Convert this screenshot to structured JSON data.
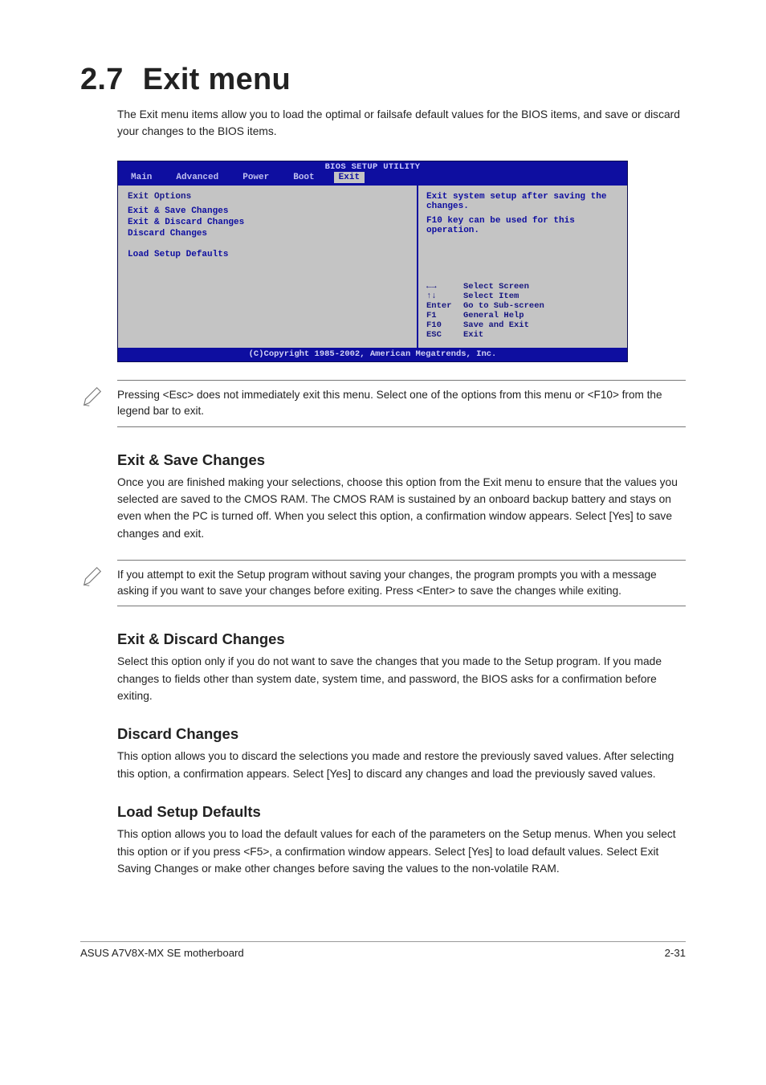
{
  "heading_number": "2.7",
  "heading_title": "Exit menu",
  "intro": "The Exit menu items allow you to load the optimal or failsafe default values for the BIOS items, and save or discard your changes to the BIOS items.",
  "bios": {
    "title": "BIOS SETUP UTILITY",
    "tabs": [
      "Main",
      "Advanced",
      "Power",
      "Boot",
      "Exit"
    ],
    "active_tab": "Exit",
    "left_section_title": "Exit Options",
    "left_items": [
      "Exit & Save Changes",
      "Exit & Discard Changes",
      "Discard Changes",
      "",
      "Load Setup Defaults"
    ],
    "right_hint_1": "Exit system setup after saving the changes.",
    "right_hint_2": "F10 key can be used for this operation.",
    "keys": [
      {
        "key": "←→",
        "label": "Select Screen"
      },
      {
        "key": "↑↓",
        "label": "Select Item"
      },
      {
        "key": "Enter",
        "label": "Go to Sub-screen"
      },
      {
        "key": "F1",
        "label": "General Help"
      },
      {
        "key": "F10",
        "label": "Save and Exit"
      },
      {
        "key": "ESC",
        "label": "Exit"
      }
    ],
    "footer": "(C)Copyright 1985-2002, American Megatrends, Inc."
  },
  "note1": "Pressing <Esc> does not immediately exit this menu. Select one of the options from this menu or <F10> from the legend bar to exit.",
  "sections": {
    "s1_title": "Exit & Save Changes",
    "s1_body": "Once you are finished making your selections, choose this option from the Exit menu to ensure that the values you selected are saved to the CMOS RAM. The CMOS RAM is sustained by an onboard backup battery and stays on even when the PC is turned off. When you select this option, a confirmation window appears. Select [Yes] to save changes and exit.",
    "note2": "If you attempt to exit the Setup program without saving your changes, the program prompts you with a message asking if you want to save your changes before exiting. Press <Enter> to save the changes while exiting.",
    "s2_title": "Exit & Discard Changes",
    "s2_body": "Select this option only if you do not want to save the changes that you made to the Setup program. If you made changes to fields other than system date, system time, and password, the BIOS asks for a confirmation before exiting.",
    "s3_title": "Discard Changes",
    "s3_body": "This option allows you to discard the selections you made and restore the previously saved values. After selecting this option, a confirmation appears. Select [Yes] to discard any changes and load the previously saved values.",
    "s4_title": "Load Setup Defaults",
    "s4_body": "This option allows you to load the default values for each of the parameters on the Setup menus. When you select this option or if you press <F5>, a confirmation window appears. Select [Yes] to load default values. Select Exit Saving Changes or make other changes before saving the values to the non-volatile RAM."
  },
  "footer_left": "ASUS A7V8X-MX SE motherboard",
  "footer_right": "2-31"
}
